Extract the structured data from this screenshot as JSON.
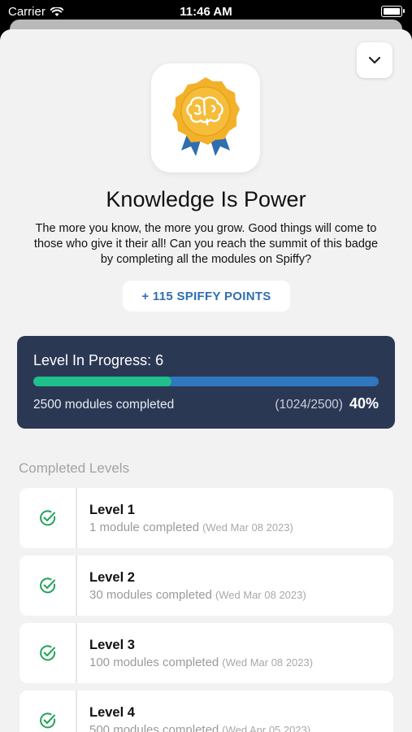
{
  "status_bar": {
    "carrier": "Carrier",
    "time": "11:46 AM"
  },
  "badge": {
    "title": "Knowledge Is Power",
    "description": "The more you know, the more you grow. Good things will come to those who give it their all! Can you reach the summit of this badge by completing all the modules on Spiffy?",
    "points_label": "+ 115 SPIFFY POINTS",
    "icon": "brain-ribbon-badge-icon"
  },
  "progress": {
    "title": "Level In Progress: 6",
    "modules_label": "2500 modules completed",
    "count_label": "(1024/2500)",
    "percent_label": "40%",
    "fraction": 0.4
  },
  "completed": {
    "title": "Completed Levels",
    "levels": [
      {
        "name": "Level 1",
        "detail": "1 module completed",
        "date": "(Wed Mar 08 2023)"
      },
      {
        "name": "Level 2",
        "detail": "30 modules completed",
        "date": "(Wed Mar 08 2023)"
      },
      {
        "name": "Level 3",
        "detail": "100 modules completed",
        "date": "(Wed Mar 08 2023)"
      },
      {
        "name": "Level 4",
        "detail": "500 modules completed",
        "date": "(Wed Apr 05 2023)"
      }
    ]
  },
  "colors": {
    "accent_blue": "#2f6fb0",
    "progress_card": "#2b3854",
    "progress_fill": "#1fc08a",
    "check_green": "#22a55a",
    "badge_gold": "#f3b12a"
  }
}
